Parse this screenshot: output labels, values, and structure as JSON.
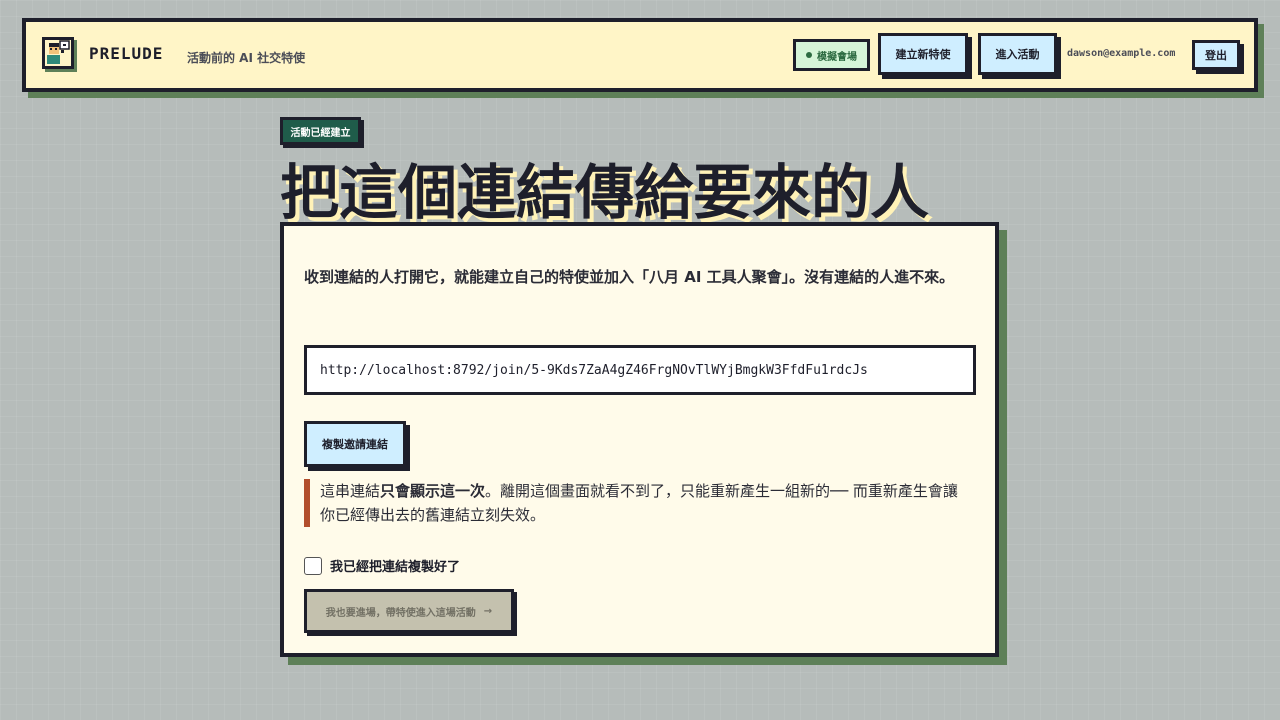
{
  "header": {
    "brand": "PRELUDE",
    "tagline": "活動前的 AI 社交特使",
    "demo_badge": "模擬會場",
    "create_button": "建立新特使",
    "enter_button": "進入活動",
    "user_email": "dawson@example.com",
    "logout_button": "登出"
  },
  "hero": {
    "status": "活動已經建立",
    "title": "把這個連結傳給要來的人"
  },
  "card": {
    "intro": "收到連結的人打開它，就能建立自己的特使並加入「八月 AI 工具人聚會」。沒有連結的人進不來。",
    "invite_link": "http://localhost:8792/join/5-9Kds7ZaA4gZ46FrgNOvTlWYjBmgkW3FfdFu1rdcJs",
    "copy_button": "複製邀請連結",
    "warning_prefix": "這串連結",
    "warning_bold": "只會顯示這一次",
    "warning_suffix": "。離開這個畫面就看不到了，只能重新產生一組新的── 而重新產生會讓你已經傳出去的舊連結立刻失效。",
    "confirm_label": "我已經把連結複製好了",
    "confirm_checked": false,
    "continue_button": "我也要進場，帶特使進入這場活動",
    "continue_arrow": "→"
  },
  "colors": {
    "header_bg": "#fff5c7",
    "accent_shadow": "#5e8058",
    "primary_button": "#cfeeff",
    "status_pill": "#1f5c4a",
    "warning_border": "#b24e2c",
    "disabled_button": "#c4c1ae"
  },
  "icons": {
    "logo": "portrait-with-speech-bubble-icon",
    "demo_status": "status-dot-icon",
    "continue": "arrow-right-icon"
  }
}
